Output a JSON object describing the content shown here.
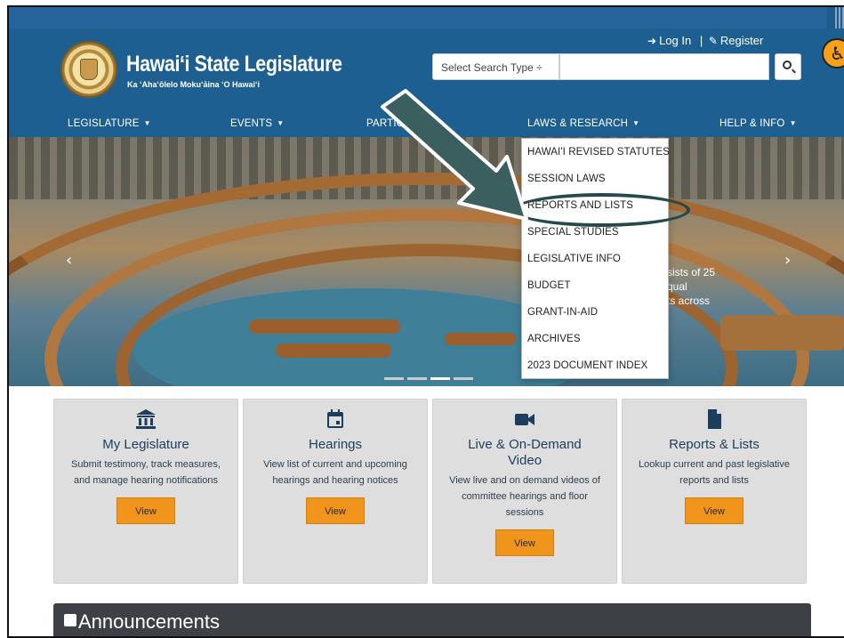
{
  "header": {
    "title": "Hawaiʻi State Legislature",
    "subtitle": "Ka ʻAhaʻōlelo Mokuʻāina ʻO Hawaiʻi",
    "login_label": "Log In",
    "separator": "|",
    "register_label": "Register",
    "search_select_placeholder": "Select Search Type ÷"
  },
  "nav": {
    "items": [
      {
        "label": "LEGISLATURE"
      },
      {
        "label": "EVENTS"
      },
      {
        "label": "PARTICIPATE"
      },
      {
        "label": "LAWS & RESEARCH"
      },
      {
        "label": "HELP & INFO"
      }
    ]
  },
  "dropdown": {
    "items": [
      "HAWAI'I REVISED STATUTES",
      "SESSION LAWS",
      "REPORTS AND LISTS",
      "SPECIAL STUDIES",
      "LEGISLATIVE INFO",
      "BUDGET",
      "GRANT-IN-AID",
      "ARCHIVES",
      "2023 DOCUMENT INDEX"
    ],
    "highlighted_item": "REPORTS AND LISTS"
  },
  "hero": {
    "text_line1": "sists of 25",
    "text_line2": "qual",
    "text_line3": "ts across"
  },
  "cards": [
    {
      "icon": "building-icon",
      "title": "My Legislature",
      "desc": "Submit testimony, track measures, and manage hearing notifications",
      "button": "View"
    },
    {
      "icon": "calendar-icon",
      "title": "Hearings",
      "desc": "View list of current and upcoming hearings and hearing notices",
      "button": "View"
    },
    {
      "icon": "video-camera-icon",
      "title": "Live & On-Demand Video",
      "desc": "View live and on demand videos of committee hearings and floor sessions",
      "button": "View"
    },
    {
      "icon": "document-icon",
      "title": "Reports & Lists",
      "desc": "Lookup current and past legislative reports and lists",
      "button": "View"
    }
  ],
  "announcements": {
    "title": "Announcements"
  },
  "colors": {
    "header_blue": "#1e5f91",
    "accent_orange": "#f0941c",
    "card_bg": "#dedede",
    "annotation_dark_teal": "#244a4c"
  }
}
